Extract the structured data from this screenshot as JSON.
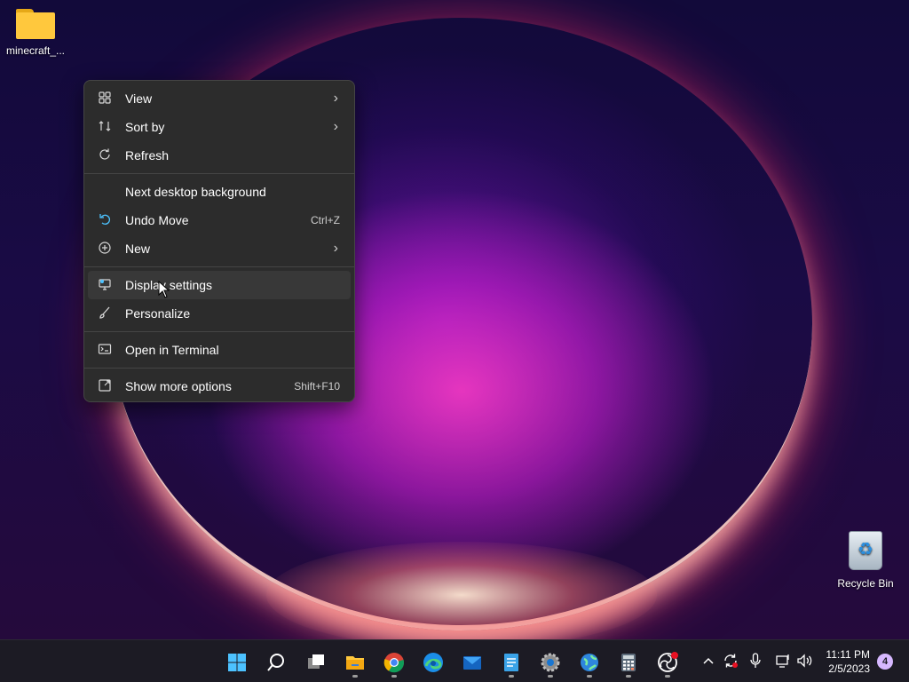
{
  "desktop": {
    "icons": [
      {
        "label": "minecraft_...",
        "icon": "folder-icon"
      },
      {
        "label": "Recycle Bin",
        "icon": "recycle-bin-icon"
      }
    ]
  },
  "context_menu": {
    "items": [
      {
        "label": "View",
        "icon": "grid-icon",
        "submenu": true
      },
      {
        "label": "Sort by",
        "icon": "sort-icon",
        "submenu": true
      },
      {
        "label": "Refresh",
        "icon": "refresh-icon"
      },
      {
        "label": "Next desktop background",
        "icon": ""
      },
      {
        "label": "Undo Move",
        "icon": "undo-icon",
        "shortcut": "Ctrl+Z"
      },
      {
        "label": "New",
        "icon": "plus-circle-icon",
        "submenu": true
      },
      {
        "label": "Display settings",
        "icon": "display-icon"
      },
      {
        "label": "Personalize",
        "icon": "brush-icon"
      },
      {
        "label": "Open in Terminal",
        "icon": "terminal-icon"
      },
      {
        "label": "Show more options",
        "icon": "expand-icon",
        "shortcut": "Shift+F10"
      }
    ],
    "hovered": "Display settings"
  },
  "taskbar": {
    "apps": [
      "start-icon",
      "search-icon",
      "task-view-icon",
      "file-explorer-icon",
      "chrome-icon",
      "edge-icon",
      "mail-icon",
      "notepad-icon",
      "settings-icon",
      "globe-app-icon",
      "calculator-icon",
      "obs-icon"
    ],
    "tray": {
      "icons": [
        "chevron-up-icon",
        "sync-icon",
        "microphone-icon",
        "network-icon",
        "volume-icon"
      ],
      "time": "11:11 PM",
      "date": "2/5/2023",
      "notifications": "4"
    }
  },
  "colors": {
    "menu_bg": "#2c2c2c",
    "accent": "#4cc2ff",
    "taskbar_bg": "#1c1b24"
  }
}
